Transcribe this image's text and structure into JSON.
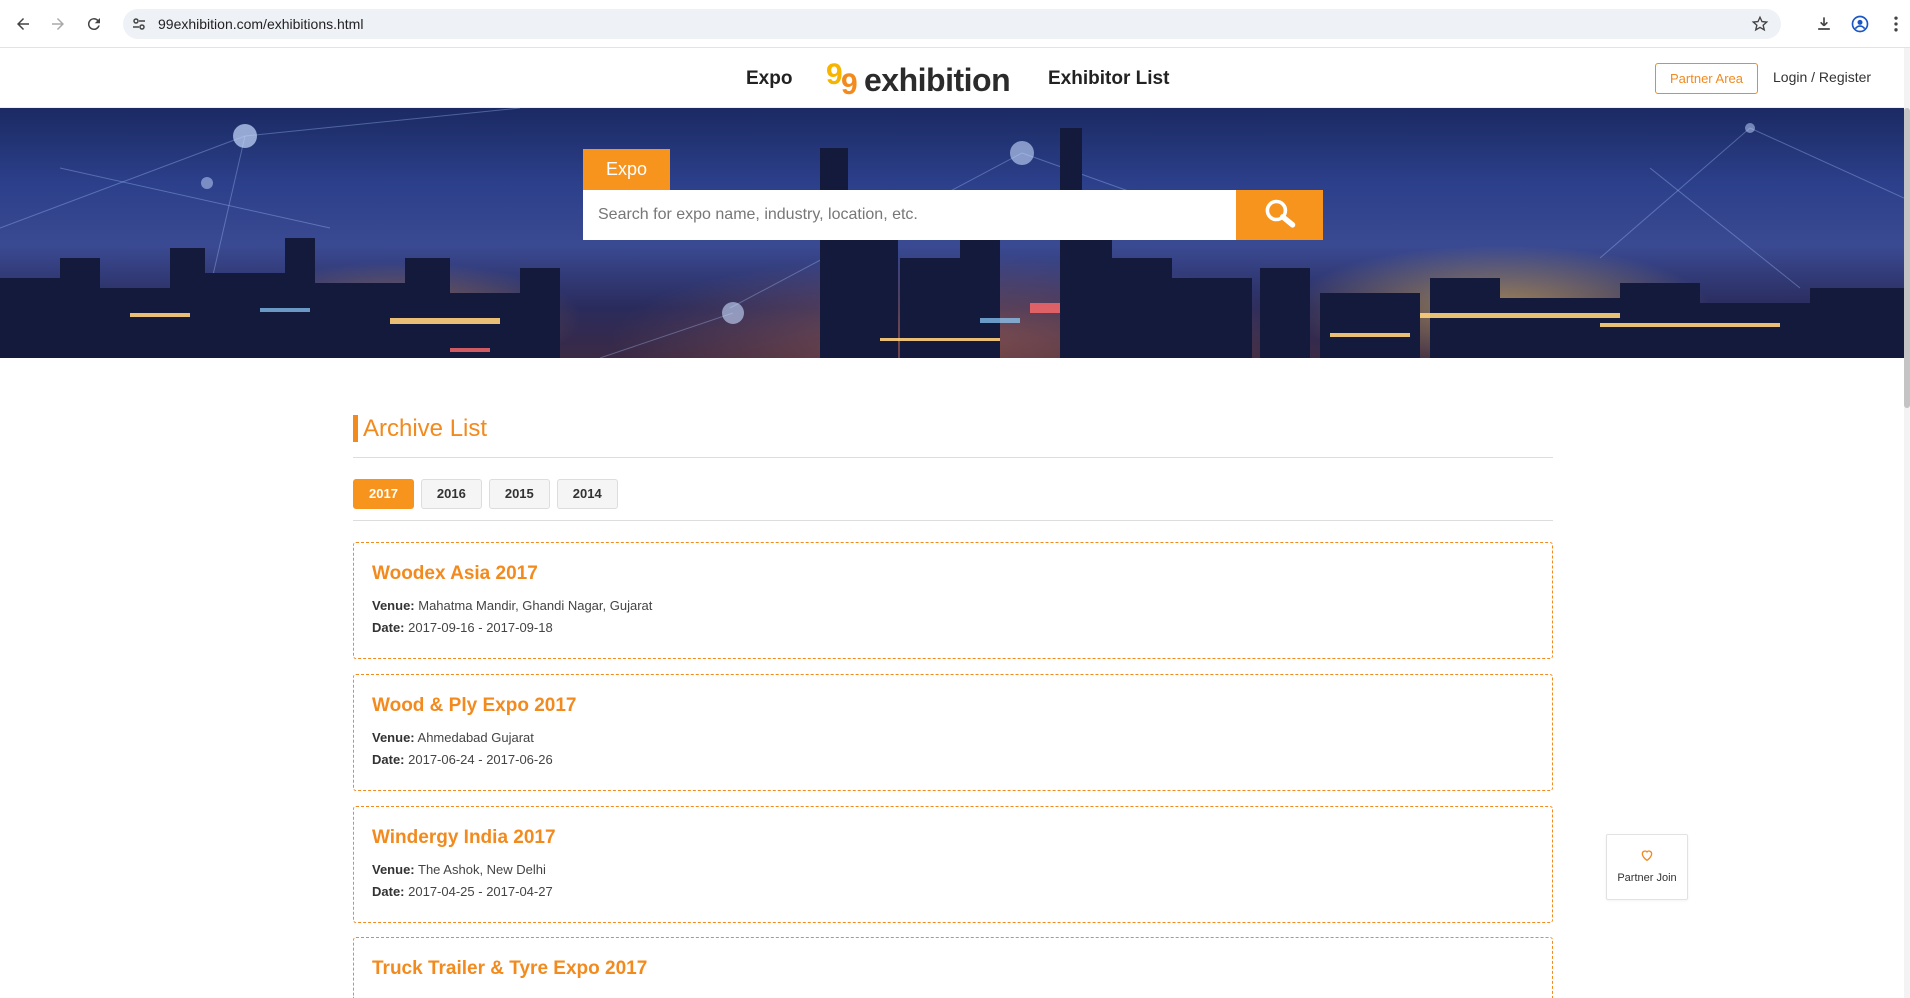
{
  "browser": {
    "url": "99exhibition.com/exhibitions.html",
    "icons": [
      "back-icon",
      "forward-icon",
      "reload-icon",
      "site-info-icon",
      "bookmark-star-icon",
      "download-icon",
      "profile-icon",
      "menu-dots-icon"
    ]
  },
  "header": {
    "nav_expo": "Expo",
    "logo_text": "exhibition",
    "nav_exhibitor_list": "Exhibitor List",
    "partner_area": "Partner Area",
    "login_register": "Login / Register"
  },
  "search": {
    "tab_label": "Expo",
    "placeholder": "Search for expo name, industry, location, etc.",
    "value": ""
  },
  "archive": {
    "title": "Archive List",
    "years": [
      "2017",
      "2016",
      "2015",
      "2014"
    ],
    "active_year": "2017",
    "venue_label": "Venue:",
    "date_label": "Date:",
    "items": [
      {
        "title": "Woodex Asia 2017",
        "venue": "Mahatma Mandir, Ghandi Nagar, Gujarat",
        "date": "2017-09-16 - 2017-09-18"
      },
      {
        "title": "Wood & Ply Expo 2017",
        "venue": "Ahmedabad Gujarat",
        "date": "2017-06-24 - 2017-06-26"
      },
      {
        "title": "Windergy India 2017",
        "venue": "The Ashok, New Delhi",
        "date": "2017-04-25 - 2017-04-27"
      },
      {
        "title": "Truck Trailer & Tyre Expo 2017",
        "venue": "",
        "date": ""
      }
    ]
  },
  "partner_join": {
    "label": "Partner Join"
  },
  "colors": {
    "accent": "#f7941d",
    "accent_text": "#f28a1e"
  }
}
